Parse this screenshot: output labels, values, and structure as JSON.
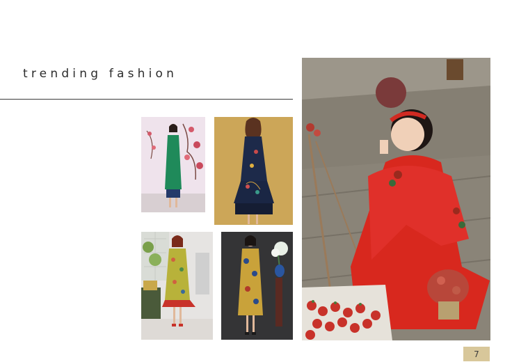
{
  "page": {
    "title": "trending fashion",
    "page_number": "7"
  },
  "photos": [
    {
      "subject": "green ao dai with blossom backdrop"
    },
    {
      "subject": "navy embroidered dress on gold background"
    },
    {
      "subject": "floral print dress in white room"
    },
    {
      "subject": "floral ao dai on dark background"
    },
    {
      "subject": "woman in red embroidered dress with strawberries"
    }
  ],
  "colors": {
    "accent": "#d8c79a",
    "rule": "#3a3a3a",
    "text": "#2b2b2b"
  }
}
